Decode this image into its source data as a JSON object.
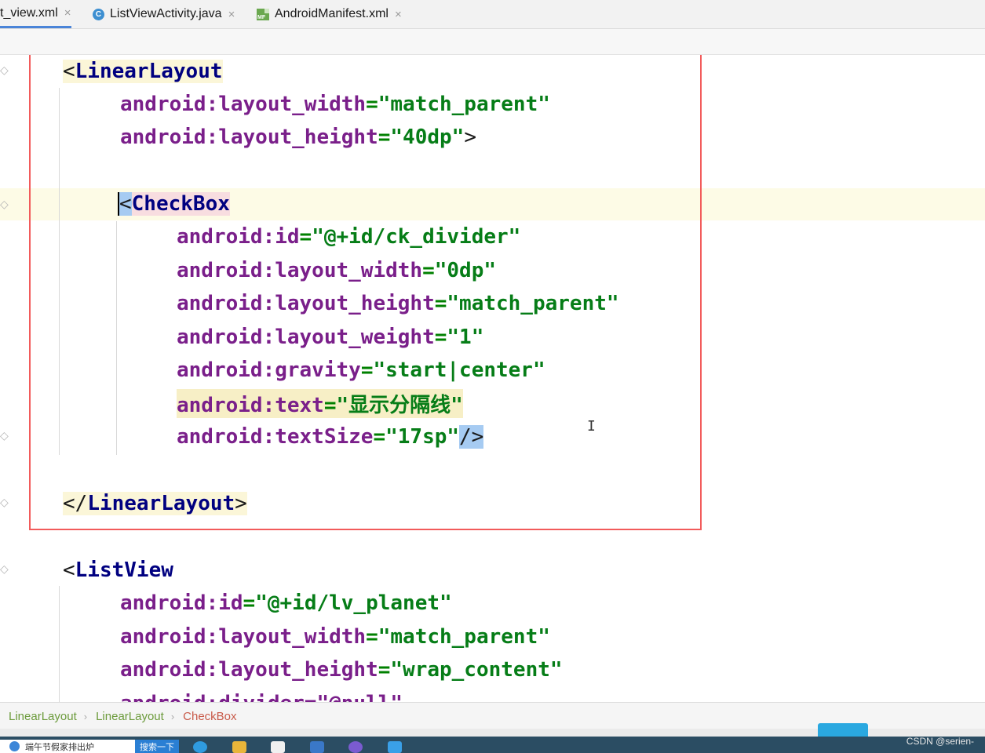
{
  "tabs": [
    {
      "label": "st_view.xml",
      "active": true
    },
    {
      "label": "ListViewActivity.java",
      "icon": "java-class-icon"
    },
    {
      "label": "AndroidManifest.xml",
      "icon": "manifest-icon"
    }
  ],
  "tab_close_glyph": "×",
  "code": {
    "l1_br": "<",
    "l1_tag": "LinearLayout",
    "l2_attr": "android:layout_width",
    "l2_val": "\"match_parent\"",
    "l3_attr": "android:layout_height",
    "l3_val": "\"40dp\"",
    "l3_end": ">",
    "l4_br": "<",
    "l4_tag": "CheckBox",
    "l5_attr": "android:id",
    "l5_val": "\"@+id/ck_divider\"",
    "l6_attr": "android:layout_width",
    "l6_val": "\"0dp\"",
    "l7_attr": "android:layout_height",
    "l7_val": "\"match_parent\"",
    "l8_attr": "android:layout_weight",
    "l8_val": "\"1\"",
    "l9_attr": "android:gravity",
    "l9_val": "\"start|center\"",
    "l10_attr": "android:text",
    "l10_val": "\"显示分隔线\"",
    "l11_attr": "android:textSize",
    "l11_val": "\"17sp\"",
    "l11_end": "/>",
    "l12_br": "</",
    "l12_tag": "LinearLayout",
    "l12_end": ">",
    "l13_br": "<",
    "l13_tag": "ListView",
    "l14_attr": "android:id",
    "l14_val": "\"@+id/lv_planet\"",
    "l15_attr": "android:layout_width",
    "l15_val": "\"match_parent\"",
    "l16_attr": "android:layout_height",
    "l16_val": "\"wrap_content\"",
    "l17_partial": "android:divider=\"@null\""
  },
  "eq": "=",
  "cursor_glyph": "I",
  "breadcrumb": [
    "LinearLayout",
    "LinearLayout",
    "CheckBox"
  ],
  "breadcrumb_sep": "›",
  "taskbar": {
    "search_text": "端午节假家排出炉",
    "search_button": "搜索一下",
    "watermark": "CSDN @serien-"
  },
  "colors": {
    "tag": "#000080",
    "attribute": "#7a1f8a",
    "value": "#067d17",
    "annotation_box": "#f25b5b",
    "selection": "#a6cbf2"
  }
}
